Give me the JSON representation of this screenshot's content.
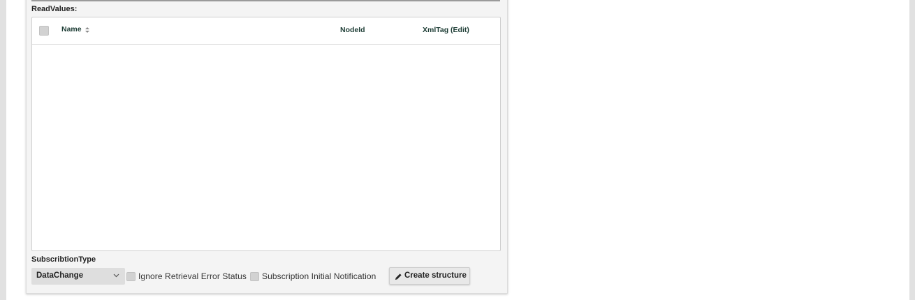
{
  "read_values": {
    "label": "ReadValues:",
    "columns": {
      "name": "Name",
      "node_id": "NodeId",
      "xml_tag": "XmlTag (Edit)"
    },
    "rows": []
  },
  "subscription": {
    "type_label": "SubscribtionType",
    "type_value": "DataChange",
    "ignore_retrieval_error_label": "Ignore Retrieval Error Status",
    "ignore_retrieval_error_checked": false,
    "initial_notification_label": "Subscription Initial Notification",
    "initial_notification_checked": false
  },
  "actions": {
    "create_structure_label": "Create structure"
  },
  "icons": {
    "sort": "sort-icon",
    "dropdown": "chevron-down-icon",
    "create": "pencil-icon"
  },
  "colors": {
    "header_text": "#1c3c34",
    "panel_bg": "#f4f4f4",
    "strip_bg": "#e1e1e1"
  }
}
